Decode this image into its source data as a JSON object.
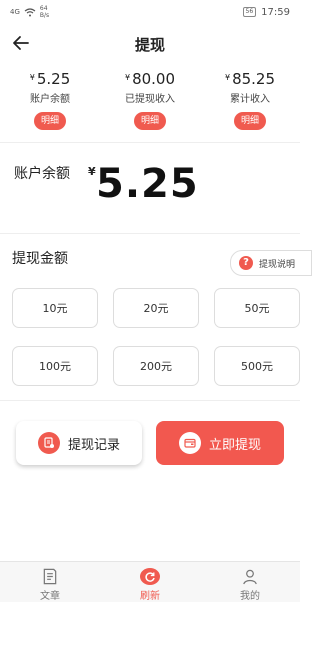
{
  "status_bar": {
    "signal": "4G",
    "speed_value": "64",
    "speed_unit": "B/s",
    "battery": "56",
    "time": "17:59"
  },
  "header": {
    "title": "提现"
  },
  "stats": [
    {
      "currency": "¥",
      "value": "5.25",
      "label": "账户余额",
      "detail_label": "明细"
    },
    {
      "currency": "¥",
      "value": "80.00",
      "label": "已提现收入",
      "detail_label": "明细"
    },
    {
      "currency": "¥",
      "value": "85.25",
      "label": "累计收入",
      "detail_label": "明细"
    }
  ],
  "balance": {
    "label": "账户余额",
    "currency": "¥",
    "value": "5.25"
  },
  "withdraw_amount": {
    "label": "提现金额",
    "explain_label": "提现说明",
    "explain_icon": "?",
    "options": [
      "10元",
      "20元",
      "50元",
      "100元",
      "200元",
      "500元"
    ]
  },
  "actions": {
    "record_label": "提现记录",
    "withdraw_label": "立即提现"
  },
  "tabbar": {
    "items": [
      {
        "label": "文章",
        "icon": "article-icon",
        "active": false
      },
      {
        "label": "刷新",
        "icon": "refresh-icon",
        "active": true
      },
      {
        "label": "我的",
        "icon": "user-icon",
        "active": false
      }
    ]
  },
  "colors": {
    "accent": "#f05a4f",
    "text": "#222222",
    "border": "#dddddd"
  }
}
